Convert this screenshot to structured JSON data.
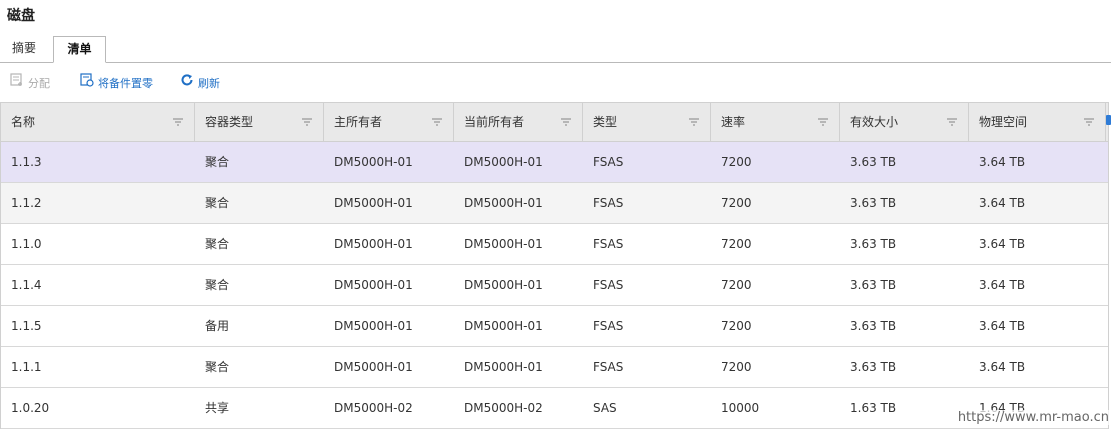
{
  "page": {
    "title": "磁盘"
  },
  "tabs": [
    {
      "label": "摘要",
      "active": false
    },
    {
      "label": "清单",
      "active": true
    }
  ],
  "toolbar": {
    "assign_label": "分配",
    "spare_label": "将备件置零",
    "refresh_label": "刷新"
  },
  "table": {
    "columns": [
      "名称",
      "容器类型",
      "主所有者",
      "当前所有者",
      "类型",
      "速率",
      "有效大小",
      "物理空间"
    ],
    "rows": [
      [
        "1.1.3",
        "聚合",
        "DM5000H-01",
        "DM5000H-01",
        "FSAS",
        "7200",
        "3.63 TB",
        "3.64 TB"
      ],
      [
        "1.1.2",
        "聚合",
        "DM5000H-01",
        "DM5000H-01",
        "FSAS",
        "7200",
        "3.63 TB",
        "3.64 TB"
      ],
      [
        "1.1.0",
        "聚合",
        "DM5000H-01",
        "DM5000H-01",
        "FSAS",
        "7200",
        "3.63 TB",
        "3.64 TB"
      ],
      [
        "1.1.4",
        "聚合",
        "DM5000H-01",
        "DM5000H-01",
        "FSAS",
        "7200",
        "3.63 TB",
        "3.64 TB"
      ],
      [
        "1.1.5",
        "备用",
        "DM5000H-01",
        "DM5000H-01",
        "FSAS",
        "7200",
        "3.63 TB",
        "3.64 TB"
      ],
      [
        "1.1.1",
        "聚合",
        "DM5000H-01",
        "DM5000H-01",
        "FSAS",
        "7200",
        "3.63 TB",
        "3.64 TB"
      ],
      [
        "1.0.20",
        "共享",
        "DM5000H-02",
        "DM5000H-02",
        "SAS",
        "10000",
        "1.63 TB",
        "1.64 TB"
      ]
    ]
  },
  "watermark": "https://www.mr-mao.cn",
  "colors": {
    "accent": "#1f6fc5",
    "selected_row": "#e6e2f6",
    "header_bg": "#e9e9e9"
  }
}
